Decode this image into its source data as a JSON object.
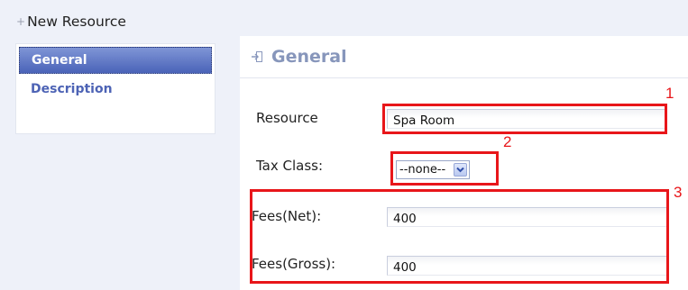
{
  "header": {
    "title": "New Resource"
  },
  "sidebar": {
    "items": [
      {
        "label": "General",
        "active": true
      },
      {
        "label": "Description",
        "active": false
      }
    ]
  },
  "section": {
    "title": "General"
  },
  "form": {
    "resource_label": "Resource",
    "resource_value": "Spa Room",
    "tax_class_label": "Tax Class:",
    "tax_class_value": "--none--",
    "fees_net_label": "Fees(Net):",
    "fees_net_value": "400",
    "fees_gross_label": "Fees(Gross):",
    "fees_gross_value": "400"
  },
  "callouts": [
    "1",
    "2",
    "3"
  ],
  "colors": {
    "callout": "#e8161a",
    "nav_active": "#5a72c4",
    "nav_link": "#4d63b5",
    "section_title": "#8796bb"
  },
  "icons": {
    "header": "plus-icon",
    "section": "section-arrow-icon",
    "select": "chevron-down-icon"
  }
}
